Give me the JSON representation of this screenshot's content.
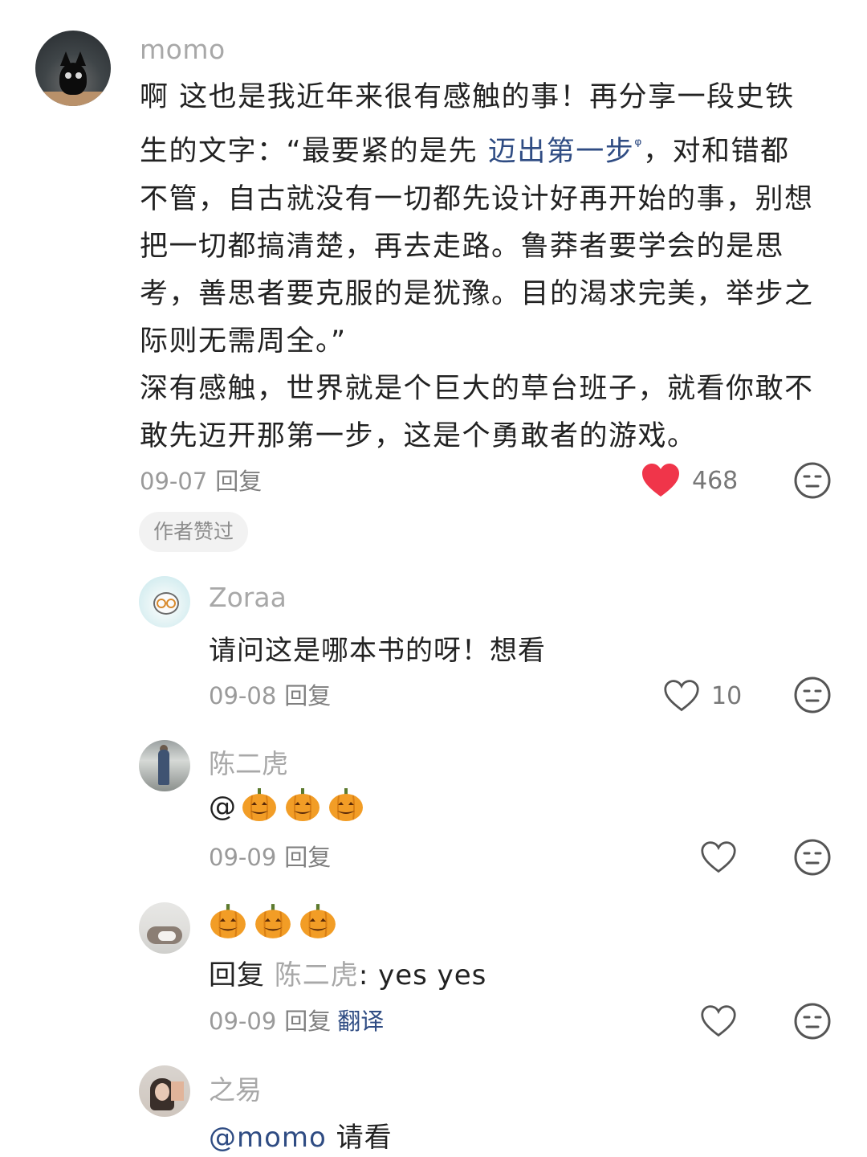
{
  "main_comment": {
    "username": "momo",
    "text_lines": [
      "啊 这也是我近年来很有感触的事！再分享一段史铁",
      "不管，自古就没有一切都先设计好再开始的事，别想",
      "把一切都搞清楚，再去走路。鲁莽者要学会的是思",
      "考，善思者要克服的是犹豫。目的渴求完美，举步之",
      "际则无需周全。”",
      "深有感触，世界就是个巨大的草台班子，就看你敢不",
      "敢先迈开那第一步，这是个勇敢者的游戏。"
    ],
    "line2_prefix": "生的文字：“最要紧的是先 ",
    "line2_link": "迈出第一步",
    "line2_suffix": "，对和错都",
    "date": "09-07",
    "reply_label": "回复",
    "like_count": "468",
    "liked": true,
    "author_badge": "作者赞过"
  },
  "replies": [
    {
      "username": "Zoraa",
      "text": "请问这是哪本书的呀！想看",
      "date": "09-08",
      "reply_label": "回复",
      "like_count": "10"
    },
    {
      "username": "陈二虎",
      "text_prefix": "@",
      "emoji_count": 3,
      "date": "09-09",
      "reply_label": "回复"
    },
    {
      "emoji_count": 3,
      "reply_word": "回复",
      "reply_to": "陈二虎",
      "reply_text": ": yes yes",
      "date": "09-09",
      "reply_label": "回复",
      "translate_label": "翻译"
    },
    {
      "username": "之易",
      "mention": "@momo",
      "text": " 请看"
    }
  ],
  "icons": {
    "heart": "heart-icon",
    "dislike": "dislike-face-icon",
    "emoji": "pumpkin-emoji"
  },
  "colors": {
    "link": "#2f4c83",
    "liked_heart": "#f0354a",
    "muted": "#a8a8a8"
  }
}
